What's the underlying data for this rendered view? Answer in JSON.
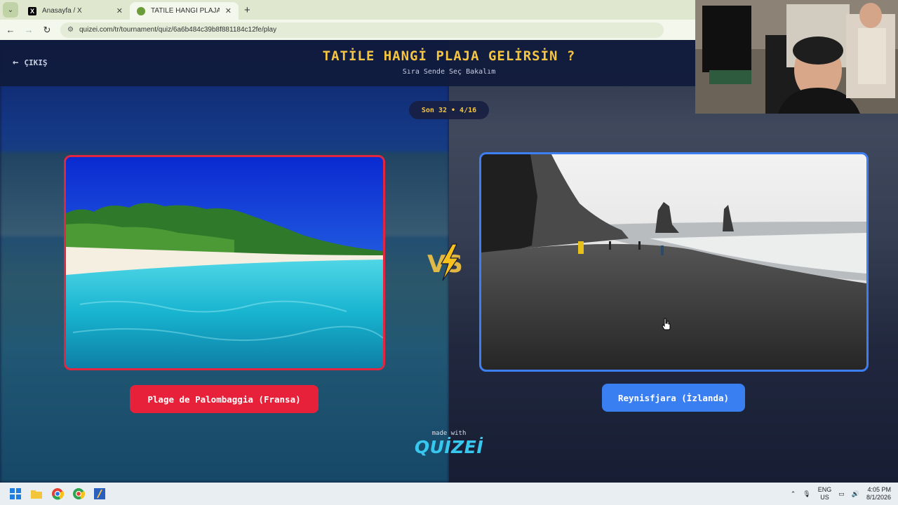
{
  "browser": {
    "tabs": [
      {
        "title": "Anasayfa / X",
        "favicon": "x-logo-icon",
        "active": false
      },
      {
        "title": "TATİLE HANGİ PLAJA GELİRSİN",
        "favicon": "quizei-favicon-icon",
        "active": true
      }
    ],
    "url": "quizei.com/tr/tournament/quiz/6a6b484c39b8f881184c12fe/play"
  },
  "header": {
    "exit_label": "ÇIKIŞ",
    "title": "TATİLE HANGİ PLAJA GELİRSİN ?",
    "subtitle": "Sıra Sende Seç Bakalım"
  },
  "round": {
    "label": "Son 32 • 4/16"
  },
  "options": [
    {
      "name": "Plage de Palombaggia (Fransa)",
      "border_color": "#e0273f",
      "image": "tropical-beach-turquoise-water"
    },
    {
      "name": "Reynisfjara (İzlanda)",
      "border_color": "#3d7ef2",
      "image": "black-sand-beach-sea-stacks"
    }
  ],
  "vs_badge": {
    "icon": "vs-lightning-icon"
  },
  "footer": {
    "made_with": "made with",
    "brand": "QUİZEİ"
  },
  "taskbar": {
    "icons": [
      "windows-start-icon",
      "file-explorer-icon",
      "chrome-icon",
      "chrome-profile-icon",
      "app-icon"
    ],
    "tray": {
      "language": "ENG",
      "region": "US",
      "time": "4:05 PM",
      "date": "8/1/2026"
    }
  },
  "colors": {
    "accent_yellow": "#f5c542",
    "left_red": "#e8213a",
    "right_blue": "#3a7ff1",
    "header_bg": "#101a3c"
  }
}
